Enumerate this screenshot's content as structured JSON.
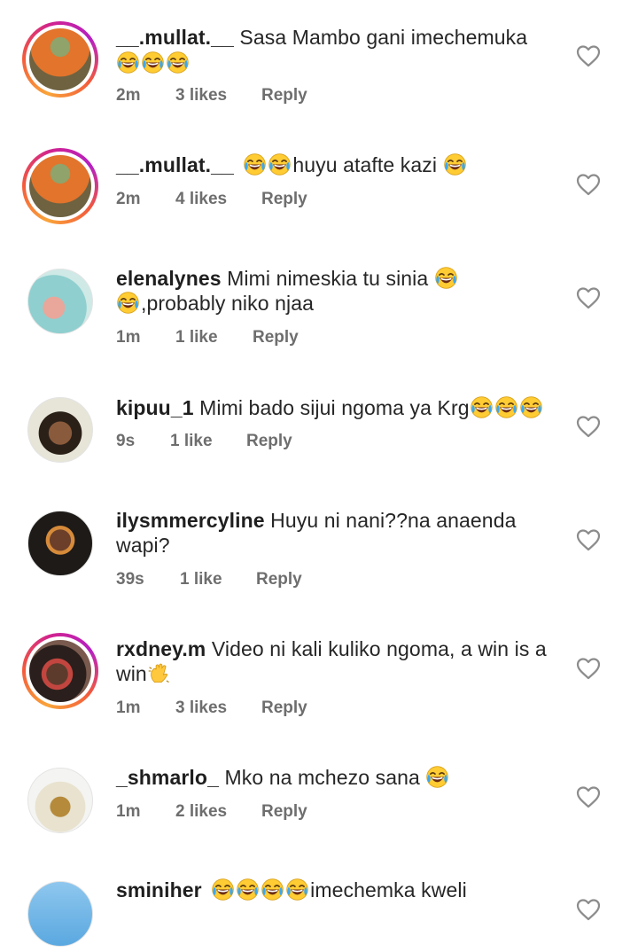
{
  "actions": {
    "reply_label": "Reply"
  },
  "comments": [
    {
      "username": "__.mullat.__",
      "text_pre": "Sasa Mambo gani imechemuka",
      "text_line2": "",
      "emoji_after": 0,
      "emoji_line2": 3,
      "text_post": "",
      "time": "2m",
      "likes": "3 likes",
      "story_ring": true,
      "avatar": "orange-hoodie"
    },
    {
      "username": "__.mullat.__",
      "text_pre": "",
      "emoji_before": 2,
      "text_post": "huyu atafte kazi",
      "emoji_after": 1,
      "time": "2m",
      "likes": "4 likes",
      "story_ring": true,
      "avatar": "orange-hoodie"
    },
    {
      "username": "elenalynes",
      "text_pre": "Mimi nimeskia tu sinia",
      "emoji_after": 1,
      "emoji_line2_before": 1,
      "text_line2": ",probably niko njaa",
      "time": "1m",
      "likes": "1 like",
      "story_ring": false,
      "avatar": "teal-photo"
    },
    {
      "username": "kipuu_1",
      "text_pre": "Mimi bado sijui ngoma ya Krg",
      "emoji_after": 3,
      "time": "9s",
      "likes": "1 like",
      "story_ring": false,
      "avatar": "cartoon-dreads"
    },
    {
      "username": "ilysmmercyline",
      "text_pre": "Huyu ni nani??na anaenda",
      "text_line2": "wapi?",
      "time": "39s",
      "likes": "1 like",
      "story_ring": false,
      "avatar": "woman-portrait"
    },
    {
      "username": "rxdney.m",
      "text_pre": "Video ni kali kuliko ngoma, a win is a",
      "text_line2": "win",
      "wave_line2": true,
      "time": "1m",
      "likes": "3 likes",
      "story_ring": true,
      "avatar": "man-cap"
    },
    {
      "username": "_shmarlo_",
      "text_pre": "Mko na mchezo sana",
      "emoji_after": 1,
      "time": "1m",
      "likes": "2 likes",
      "story_ring": false,
      "avatar": "trophy-cup"
    },
    {
      "username": "sminiher",
      "text_pre": "",
      "emoji_before": 4,
      "text_post": "imechemka kweli",
      "time": "",
      "likes": "",
      "story_ring": false,
      "avatar": "blue-sky"
    }
  ]
}
